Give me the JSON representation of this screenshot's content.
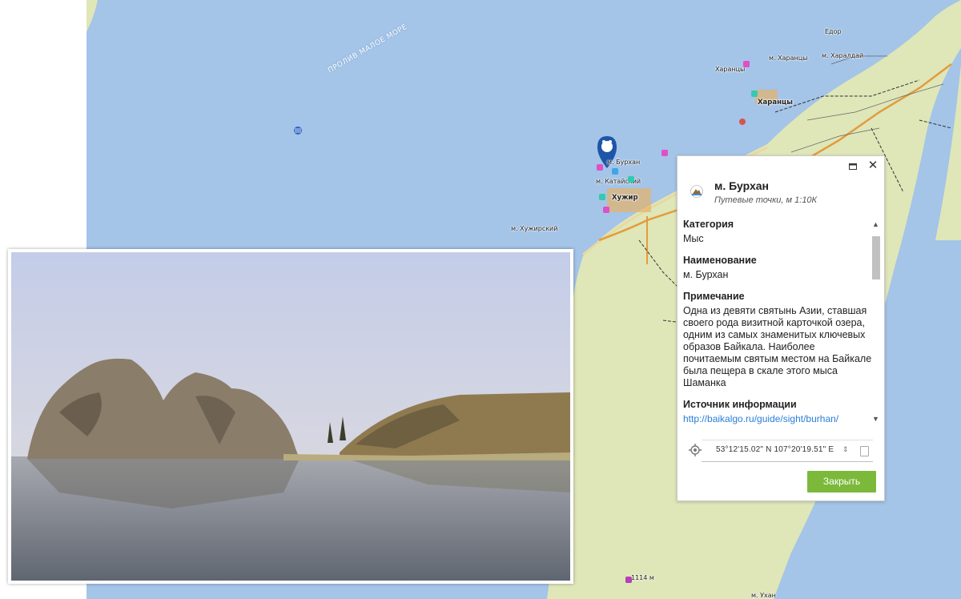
{
  "map": {
    "colors": {
      "water": "#a4c4e8",
      "land": "#dfe6b8",
      "accent_green": "#7cb93a"
    },
    "strait_label": "ПРОЛИВ МАЛОЕ МОРЕ",
    "labels": {
      "edor": "Едор",
      "m_kharancy": "м. Харанцы",
      "kharancy_dot": "Харанцы",
      "kharancy_town": "Харанцы",
      "kharaldai": "м. Харалдай",
      "m_burkhan": "м. Бурхан",
      "m_kataiskii": "м. Катайский",
      "khuzhir": "Хужир",
      "m_khuzhirskii": "м. Хужирский",
      "elev_1114": "1114 м",
      "m_ukhan": "м. Ухан"
    }
  },
  "popup": {
    "title": "м. Бурхан",
    "subtitle": "Путевые точки, м 1:10К",
    "fields": [
      {
        "label": "Категория",
        "value": "Мыс"
      },
      {
        "label": "Наименование",
        "value": "м. Бурхан"
      },
      {
        "label": "Примечание",
        "value": "Одна из девяти святынь Азии, ставшая своего рода визитной карточкой озера, одним из самых знаменитых ключевых образов Байкала. Наиболее почитаемым святым местом на Байкале была пещера в скале этого мыса Шаманка"
      },
      {
        "label": "Источник информации",
        "value": "http://baikalgo.ru/guide/sight/burhan/"
      }
    ],
    "coordinates": "53°12'15.02\" N 107°20'19.51\" E",
    "close_button": "Закрыть"
  }
}
